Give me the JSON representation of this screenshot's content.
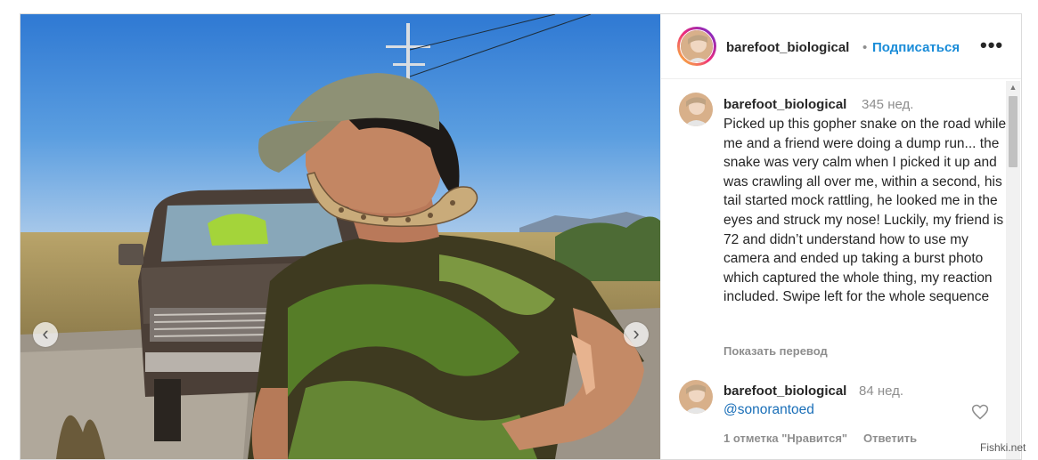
{
  "post": {
    "username": "barefoot_biological",
    "follow_label": "Подписаться",
    "separator": "•",
    "more_label": "•••",
    "caption": {
      "username": "barefoot_biological",
      "time": "345 нед.",
      "text": "Picked up this gopher snake on the road while me and a friend were doing a dump run... the snake was very calm when I picked it up and was crawling all over me, within a second, his tail started mock rattling, he looked me in the eyes and struck my nose! Luckily, my friend is 72 and didn’t understand how to use my camera and ended up taking a burst photo which captured the whole thing, my reaction included. Swipe left for the whole sequence",
      "translate_label": "Показать перевод"
    },
    "comment": {
      "username": "barefoot_biological",
      "time": "84 нед.",
      "mention": "@sonorantoed",
      "likes_label": "1 отметка \"Нравится\"",
      "reply_label": "Ответить"
    },
    "carousel": {
      "prev_label": "‹",
      "next_label": "›"
    }
  },
  "watermark": "Fishki.net",
  "colors": {
    "link": "#1a8cd8",
    "sky": "#4a8fd8",
    "meta_text": "#8e8e8e"
  },
  "icons": [
    "more-options-icon",
    "heart-icon",
    "chevron-left-icon",
    "chevron-right-icon",
    "scroll-up-icon"
  ]
}
